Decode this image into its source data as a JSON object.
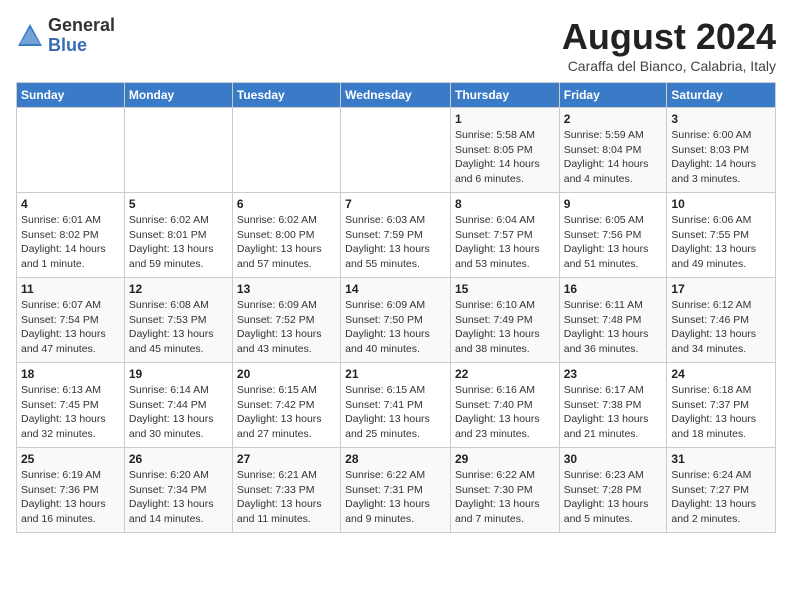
{
  "header": {
    "logo_general": "General",
    "logo_blue": "Blue",
    "month_year": "August 2024",
    "location": "Caraffa del Bianco, Calabria, Italy"
  },
  "weekdays": [
    "Sunday",
    "Monday",
    "Tuesday",
    "Wednesday",
    "Thursday",
    "Friday",
    "Saturday"
  ],
  "weeks": [
    [
      {
        "day": "",
        "detail": ""
      },
      {
        "day": "",
        "detail": ""
      },
      {
        "day": "",
        "detail": ""
      },
      {
        "day": "",
        "detail": ""
      },
      {
        "day": "1",
        "detail": "Sunrise: 5:58 AM\nSunset: 8:05 PM\nDaylight: 14 hours\nand 6 minutes."
      },
      {
        "day": "2",
        "detail": "Sunrise: 5:59 AM\nSunset: 8:04 PM\nDaylight: 14 hours\nand 4 minutes."
      },
      {
        "day": "3",
        "detail": "Sunrise: 6:00 AM\nSunset: 8:03 PM\nDaylight: 14 hours\nand 3 minutes."
      }
    ],
    [
      {
        "day": "4",
        "detail": "Sunrise: 6:01 AM\nSunset: 8:02 PM\nDaylight: 14 hours\nand 1 minute."
      },
      {
        "day": "5",
        "detail": "Sunrise: 6:02 AM\nSunset: 8:01 PM\nDaylight: 13 hours\nand 59 minutes."
      },
      {
        "day": "6",
        "detail": "Sunrise: 6:02 AM\nSunset: 8:00 PM\nDaylight: 13 hours\nand 57 minutes."
      },
      {
        "day": "7",
        "detail": "Sunrise: 6:03 AM\nSunset: 7:59 PM\nDaylight: 13 hours\nand 55 minutes."
      },
      {
        "day": "8",
        "detail": "Sunrise: 6:04 AM\nSunset: 7:57 PM\nDaylight: 13 hours\nand 53 minutes."
      },
      {
        "day": "9",
        "detail": "Sunrise: 6:05 AM\nSunset: 7:56 PM\nDaylight: 13 hours\nand 51 minutes."
      },
      {
        "day": "10",
        "detail": "Sunrise: 6:06 AM\nSunset: 7:55 PM\nDaylight: 13 hours\nand 49 minutes."
      }
    ],
    [
      {
        "day": "11",
        "detail": "Sunrise: 6:07 AM\nSunset: 7:54 PM\nDaylight: 13 hours\nand 47 minutes."
      },
      {
        "day": "12",
        "detail": "Sunrise: 6:08 AM\nSunset: 7:53 PM\nDaylight: 13 hours\nand 45 minutes."
      },
      {
        "day": "13",
        "detail": "Sunrise: 6:09 AM\nSunset: 7:52 PM\nDaylight: 13 hours\nand 43 minutes."
      },
      {
        "day": "14",
        "detail": "Sunrise: 6:09 AM\nSunset: 7:50 PM\nDaylight: 13 hours\nand 40 minutes."
      },
      {
        "day": "15",
        "detail": "Sunrise: 6:10 AM\nSunset: 7:49 PM\nDaylight: 13 hours\nand 38 minutes."
      },
      {
        "day": "16",
        "detail": "Sunrise: 6:11 AM\nSunset: 7:48 PM\nDaylight: 13 hours\nand 36 minutes."
      },
      {
        "day": "17",
        "detail": "Sunrise: 6:12 AM\nSunset: 7:46 PM\nDaylight: 13 hours\nand 34 minutes."
      }
    ],
    [
      {
        "day": "18",
        "detail": "Sunrise: 6:13 AM\nSunset: 7:45 PM\nDaylight: 13 hours\nand 32 minutes."
      },
      {
        "day": "19",
        "detail": "Sunrise: 6:14 AM\nSunset: 7:44 PM\nDaylight: 13 hours\nand 30 minutes."
      },
      {
        "day": "20",
        "detail": "Sunrise: 6:15 AM\nSunset: 7:42 PM\nDaylight: 13 hours\nand 27 minutes."
      },
      {
        "day": "21",
        "detail": "Sunrise: 6:15 AM\nSunset: 7:41 PM\nDaylight: 13 hours\nand 25 minutes."
      },
      {
        "day": "22",
        "detail": "Sunrise: 6:16 AM\nSunset: 7:40 PM\nDaylight: 13 hours\nand 23 minutes."
      },
      {
        "day": "23",
        "detail": "Sunrise: 6:17 AM\nSunset: 7:38 PM\nDaylight: 13 hours\nand 21 minutes."
      },
      {
        "day": "24",
        "detail": "Sunrise: 6:18 AM\nSunset: 7:37 PM\nDaylight: 13 hours\nand 18 minutes."
      }
    ],
    [
      {
        "day": "25",
        "detail": "Sunrise: 6:19 AM\nSunset: 7:36 PM\nDaylight: 13 hours\nand 16 minutes."
      },
      {
        "day": "26",
        "detail": "Sunrise: 6:20 AM\nSunset: 7:34 PM\nDaylight: 13 hours\nand 14 minutes."
      },
      {
        "day": "27",
        "detail": "Sunrise: 6:21 AM\nSunset: 7:33 PM\nDaylight: 13 hours\nand 11 minutes."
      },
      {
        "day": "28",
        "detail": "Sunrise: 6:22 AM\nSunset: 7:31 PM\nDaylight: 13 hours\nand 9 minutes."
      },
      {
        "day": "29",
        "detail": "Sunrise: 6:22 AM\nSunset: 7:30 PM\nDaylight: 13 hours\nand 7 minutes."
      },
      {
        "day": "30",
        "detail": "Sunrise: 6:23 AM\nSunset: 7:28 PM\nDaylight: 13 hours\nand 5 minutes."
      },
      {
        "day": "31",
        "detail": "Sunrise: 6:24 AM\nSunset: 7:27 PM\nDaylight: 13 hours\nand 2 minutes."
      }
    ]
  ]
}
